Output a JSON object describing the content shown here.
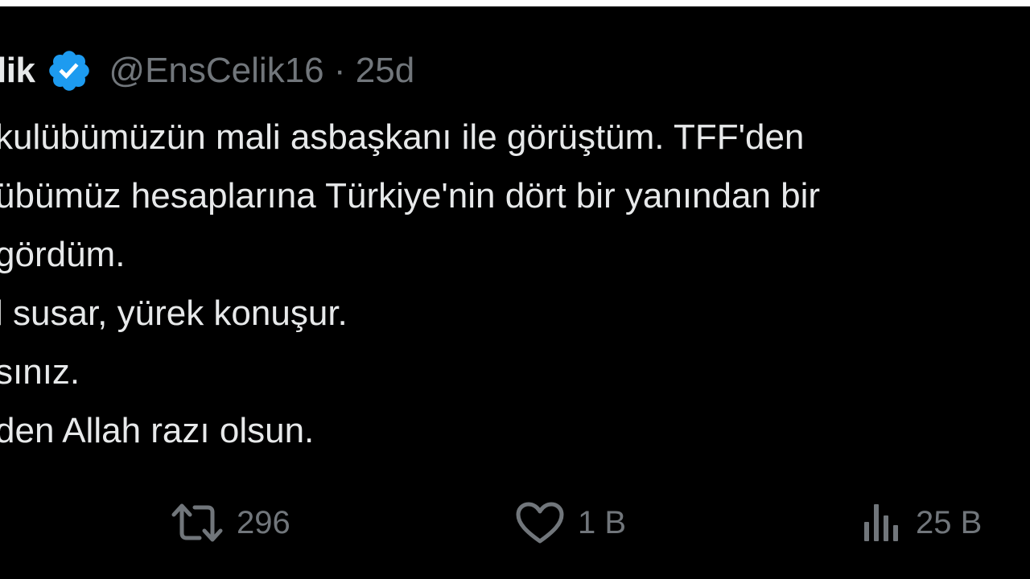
{
  "colors": {
    "background": "#000000",
    "text_primary": "#e7e9ea",
    "text_secondary": "#71767b",
    "verified_badge": "#1d9bf0"
  },
  "author": {
    "display_name_visible": "lik",
    "verified_icon": "verified-badge-icon",
    "handle": "@EnsCelik16",
    "separator": "·",
    "age": "25d"
  },
  "tweet": {
    "lines": [
      "kulübümüzün mali asbaşkanı ile görüştüm. TFF'den",
      "übümüz hesaplarına Türkiye'nin dört bir yanından bir",
      "gördüm.",
      "l susar, yürek konuşur.",
      "sınız.",
      "den Allah razı olsun."
    ]
  },
  "actions": {
    "retweet": {
      "icon": "retweet-icon",
      "count": "296"
    },
    "like": {
      "icon": "heart-icon",
      "count": "1 B"
    },
    "views": {
      "icon": "views-chart-icon",
      "count": "25 B"
    }
  }
}
